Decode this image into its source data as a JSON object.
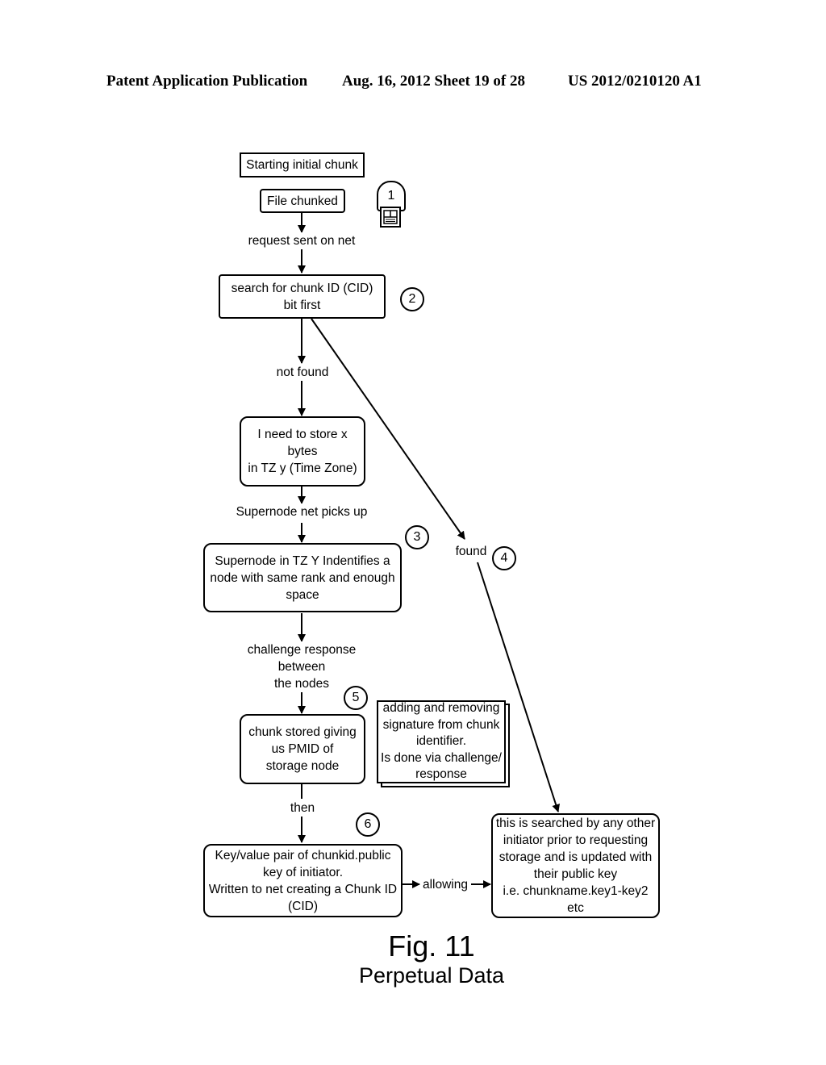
{
  "header": {
    "left": "Patent Application Publication",
    "date_sheet": "Aug. 16, 2012  Sheet 19 of 28",
    "pub_number": "US 2012/0210120 A1"
  },
  "nodes": {
    "start": "Starting initial chunk",
    "file_chunked": "File chunked",
    "search": "search for chunk ID (CID)\nbit first",
    "need_store": "I need to store x bytes\nin TZ y (Time Zone)",
    "supernode": "Supernode in TZ Y Indentifies a\nnode with same rank and enough\nspace",
    "chunk_stored": "chunk stored giving\nus PMID of\nstorage node",
    "note": "adding and removing\nsignature from chunk\nidentifier.\nIs done via challenge/\nresponse",
    "keyvalue": "Key/value pair of chunkid.public\nkey of initiator.\nWritten to net creating a Chunk ID\n(CID)",
    "searched": "this is searched by any other\ninitiator prior to requesting\nstorage and is updated with\ntheir public key\ni.e. chunkname.key1-key2 etc"
  },
  "edge_labels": {
    "request_sent": "request sent on net",
    "not_found": "not found",
    "supernode_picks": "Supernode net picks up",
    "challenge": "challenge response\nbetween\nthe nodes",
    "then": "then",
    "found": "found",
    "allowing": "allowing"
  },
  "step_markers": [
    "1",
    "2",
    "3",
    "4",
    "5",
    "6"
  ],
  "icons": {
    "step1_icon": "document-terminal-icon"
  },
  "caption": {
    "figure": "Fig. 11",
    "title": "Perpetual Data"
  }
}
